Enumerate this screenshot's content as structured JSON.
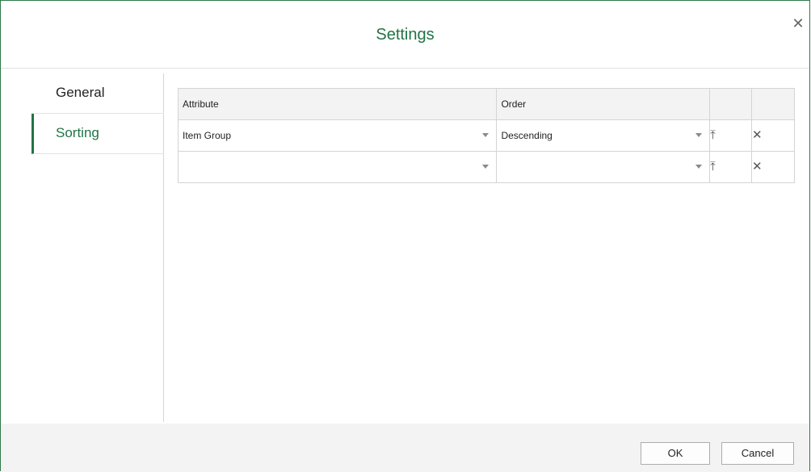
{
  "dialog": {
    "title": "Settings",
    "close_glyph": "✕"
  },
  "sidebar": {
    "items": [
      {
        "label": "General",
        "active": false
      },
      {
        "label": "Sorting",
        "active": true
      }
    ]
  },
  "sort_table": {
    "headers": {
      "attribute": "Attribute",
      "order": "Order",
      "move": "",
      "remove": ""
    },
    "rows": [
      {
        "attribute": "Item Group",
        "order": "Descending"
      },
      {
        "attribute": "",
        "order": ""
      }
    ],
    "move_top_icon": "move-to-top-icon",
    "move_top_glyph": "⤒",
    "remove_icon": "remove-icon",
    "remove_glyph": "✕"
  },
  "footer": {
    "ok_label": "OK",
    "cancel_label": "Cancel"
  },
  "colors": {
    "accent": "#217346",
    "border": "#2e7a4a",
    "footer_bg": "#f3f3f3"
  }
}
